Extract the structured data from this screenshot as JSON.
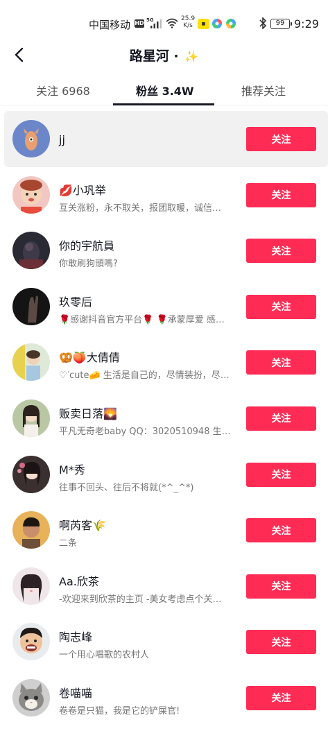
{
  "status_bar": {
    "carrier": "中国移动",
    "hd": "HD",
    "network": "5G",
    "speed_value": "25.9",
    "speed_unit": "K/s",
    "battery": "99",
    "time": "9:29"
  },
  "header": {
    "title": "路星河",
    "title_suffix": " · ",
    "sparkle": "✨"
  },
  "tabs": [
    {
      "label": "关注 6968"
    },
    {
      "label": "粉丝 3.4W"
    },
    {
      "label": "推荐关注"
    }
  ],
  "follow_label": "关注",
  "users": [
    {
      "name": "jj",
      "desc": ""
    },
    {
      "name": "💋小巩举",
      "desc": "互关涨粉，永不取关，报团取暖，诚信…"
    },
    {
      "name": "你的宇航員",
      "desc": "你敢刷狗頭嗎?"
    },
    {
      "name": "玖零后",
      "desc": "🌹感谢抖音官方平台🌹 🌹承蒙厚爱  感…"
    },
    {
      "name": "🥨🍑大倩倩",
      "desc": "♡ᐝcute🧀 生活是自己的，尽情装扮，尽…"
    },
    {
      "name": "贩卖日落🌄",
      "desc": "平凡无奇老baby QQ：3020510948 生…"
    },
    {
      "name": "M*秀",
      "desc": "往事不回头、往后不将就(*^_^*)"
    },
    {
      "name": "啊芮客🌾",
      "desc": "二条"
    },
    {
      "name": "Aa.欣茶",
      "desc": "-欢迎来到欣茶的主页 -美女考虑点个关…"
    },
    {
      "name": "陶志峰",
      "desc": "一个用心唱歌的农村人"
    },
    {
      "name": "卷喵喵",
      "desc": "卷卷是只猫，我是它的铲屎官!"
    }
  ],
  "colors": {
    "accent": "#fe2c55",
    "highlight_row": "#f1f1f2",
    "text_primary": "#161823",
    "text_secondary": "#757575"
  }
}
